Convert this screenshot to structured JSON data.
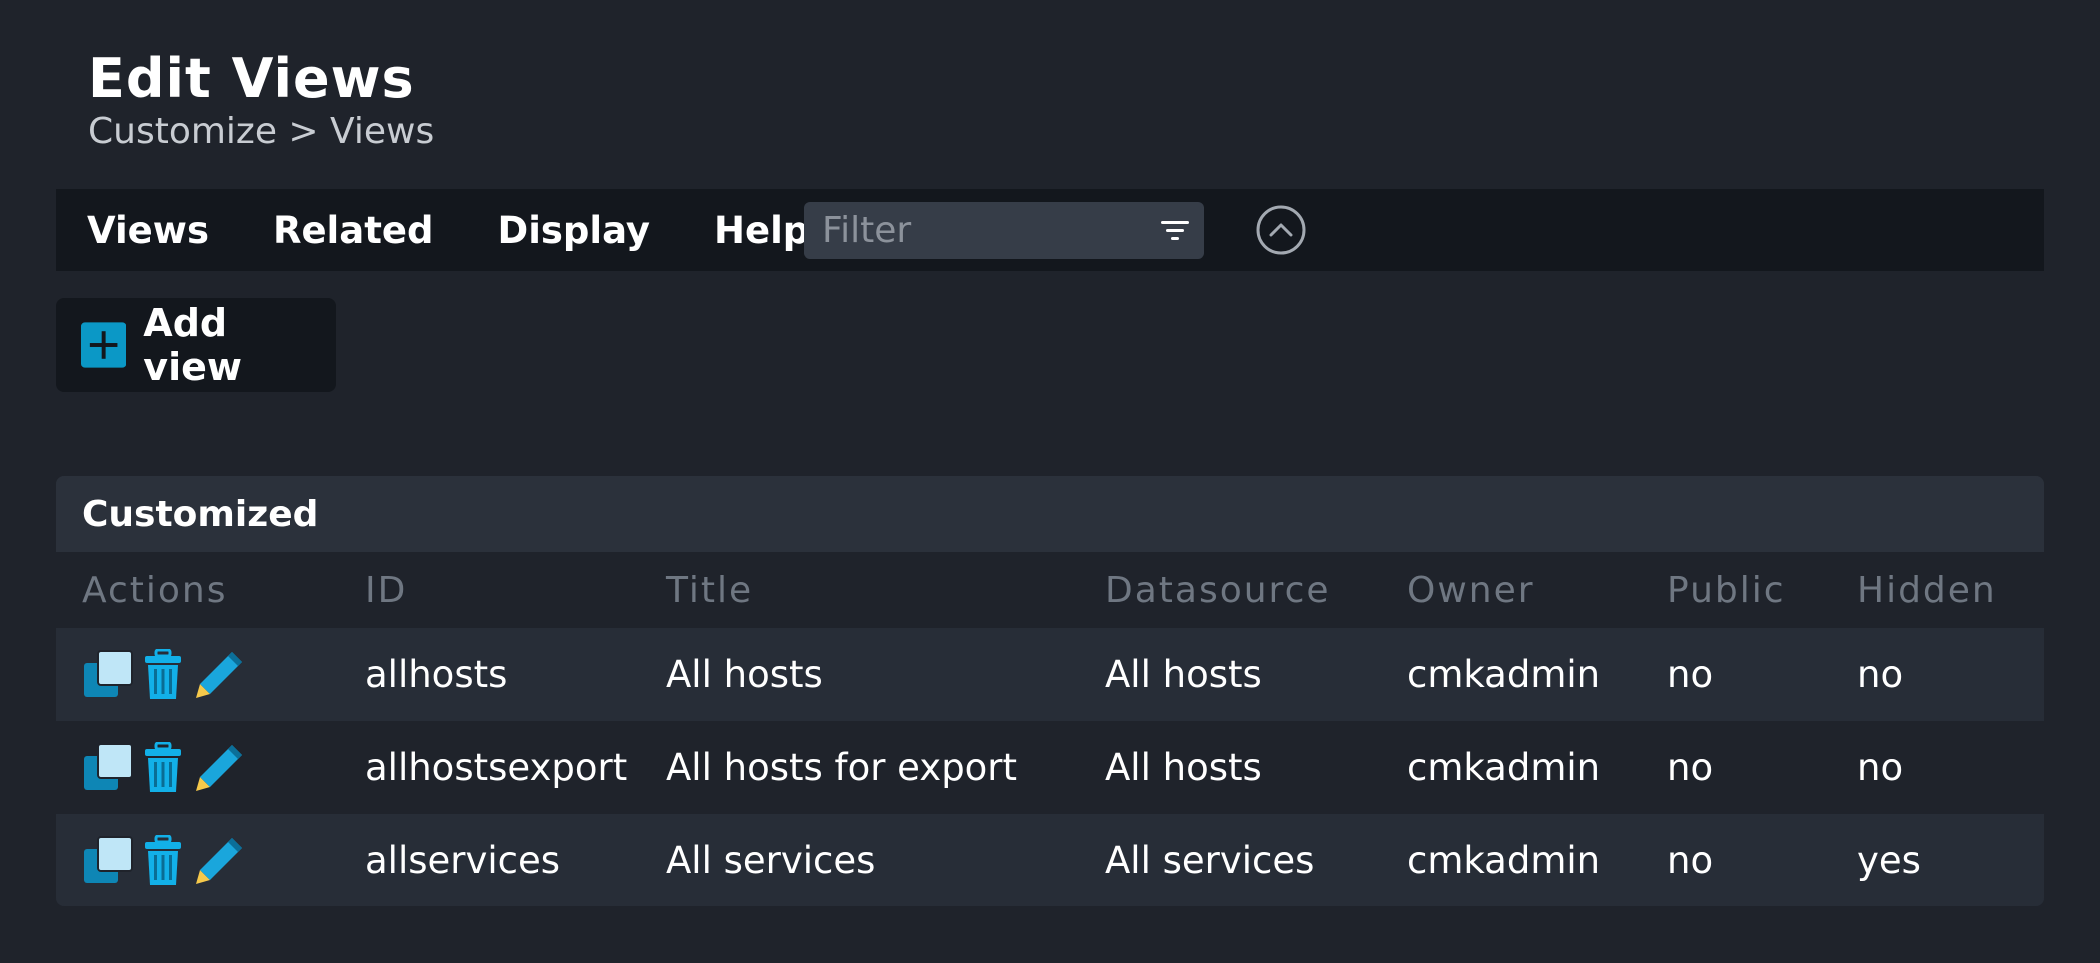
{
  "header": {
    "title": "Edit Views",
    "breadcrumb": "Customize > Views"
  },
  "menubar": {
    "items": [
      "Views",
      "Related",
      "Display",
      "Help"
    ],
    "filter_placeholder": "Filter"
  },
  "add_view_label": "Add view",
  "colors": {
    "accent": "#0b98c6",
    "background": "#1f232b",
    "menubar": "#13171d",
    "pencil": "#f6c94b"
  },
  "table": {
    "caption": "Customized",
    "columns": [
      "Actions",
      "ID",
      "Title",
      "Datasource",
      "Owner",
      "Public",
      "Hidden"
    ],
    "rows": [
      {
        "id": "allhosts",
        "title": "All hosts",
        "datasource": "All hosts",
        "owner": "cmkadmin",
        "public": "no",
        "hidden": "no"
      },
      {
        "id": "allhostsexport",
        "title": "All hosts for export",
        "datasource": "All hosts",
        "owner": "cmkadmin",
        "public": "no",
        "hidden": "no"
      },
      {
        "id": "allservices",
        "title": "All services",
        "datasource": "All services",
        "owner": "cmkadmin",
        "public": "no",
        "hidden": "yes"
      }
    ],
    "action_icons": [
      "clone-icon",
      "trash-icon",
      "edit-pencil-icon"
    ]
  }
}
